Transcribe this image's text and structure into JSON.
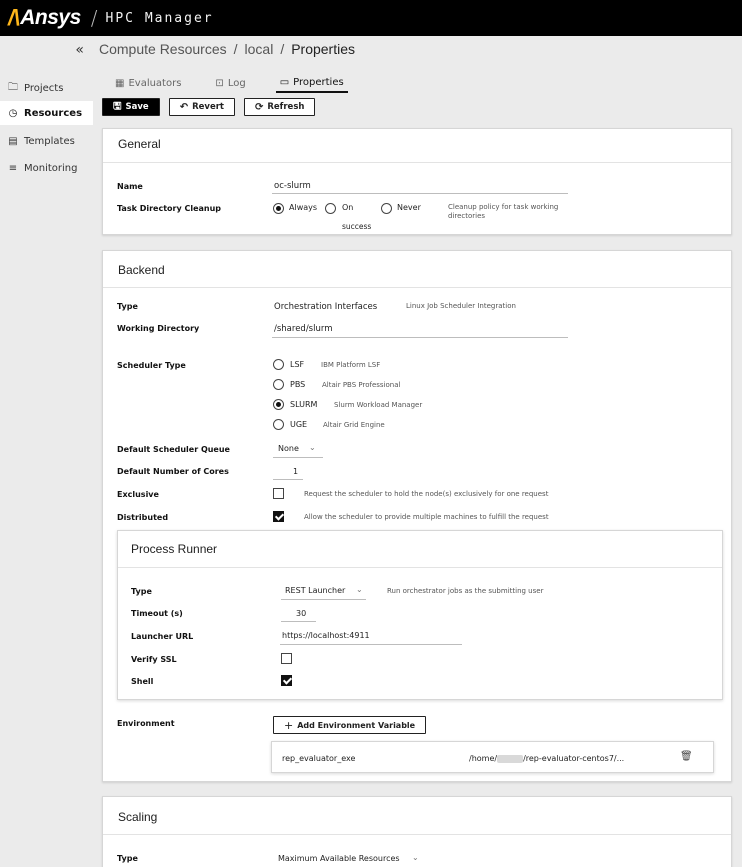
{
  "header": {
    "brand": "Ansys",
    "app_title": "HPC Manager"
  },
  "sidebar": {
    "collapse_glyph": "«",
    "items": [
      {
        "label": "Projects",
        "icon": "folder-icon",
        "glyph": "🗀",
        "active": false
      },
      {
        "label": "Resources",
        "icon": "gauge-icon",
        "glyph": "◷",
        "active": true
      },
      {
        "label": "Templates",
        "icon": "template-icon",
        "glyph": "▤",
        "active": false
      },
      {
        "label": "Monitoring",
        "icon": "monitoring-icon",
        "glyph": "≡",
        "active": false
      }
    ]
  },
  "breadcrumb": {
    "part1": "Compute Resources",
    "part2": "local",
    "part3": "Properties",
    "sep": "/"
  },
  "tabs": [
    {
      "label": "Evaluators",
      "icon": "evaluators-icon",
      "glyph": "▦"
    },
    {
      "label": "Log",
      "icon": "log-icon",
      "glyph": "⊡"
    },
    {
      "label": "Properties",
      "icon": "properties-icon",
      "glyph": "▭"
    }
  ],
  "toolbar": {
    "save": "Save",
    "revert": "Revert",
    "refresh": "Refresh"
  },
  "general": {
    "title": "General",
    "name_label": "Name",
    "name_value": "oc-slurm",
    "cleanup_label": "Task Directory Cleanup",
    "options": {
      "always": "Always",
      "on": "On",
      "on_cont": "success",
      "never": "Never"
    },
    "hint_line1": "Cleanup policy for task working",
    "hint_line2": "directories"
  },
  "backend": {
    "title": "Backend",
    "type_label": "Type",
    "type_value": "Orchestration Interfaces",
    "type_hint": "Linux Job Scheduler Integration",
    "workdir_label": "Working Directory",
    "workdir_value": "/shared/slurm",
    "scheduler_label": "Scheduler Type",
    "schedulers": [
      {
        "name": "LSF",
        "desc": "IBM Platform LSF"
      },
      {
        "name": "PBS",
        "desc": "Altair PBS Professional"
      },
      {
        "name": "SLURM",
        "desc": "Slurm Workload Manager"
      },
      {
        "name": "UGE",
        "desc": "Altair Grid Engine"
      }
    ],
    "queue_label": "Default Scheduler Queue",
    "queue_value": "None",
    "cores_label": "Default Number of Cores",
    "cores_value": "1",
    "exclusive_label": "Exclusive",
    "exclusive_hint": "Request the scheduler to hold the node(s) exclusively for one request",
    "distributed_label": "Distributed",
    "distributed_hint": "Allow the scheduler to provide multiple machines to fulfill the request",
    "environment_label": "Environment",
    "add_env_label": "Add Environment Variable",
    "env_var": {
      "name": "rep_evaluator_exe",
      "value_pre": "/home/",
      "value_post": "/rep-evaluator-centos7/..."
    }
  },
  "process_runner": {
    "title": "Process Runner",
    "type_label": "Type",
    "type_value": "REST Launcher",
    "type_hint": "Run orchestrator jobs as the submitting user",
    "timeout_label": "Timeout (s)",
    "timeout_value": "30",
    "url_label": "Launcher URL",
    "url_value": "https://localhost:4911",
    "ssl_label": "Verify SSL",
    "shell_label": "Shell"
  },
  "scaling": {
    "title": "Scaling",
    "type_label": "Type",
    "type_value": "Maximum Available Resources"
  }
}
